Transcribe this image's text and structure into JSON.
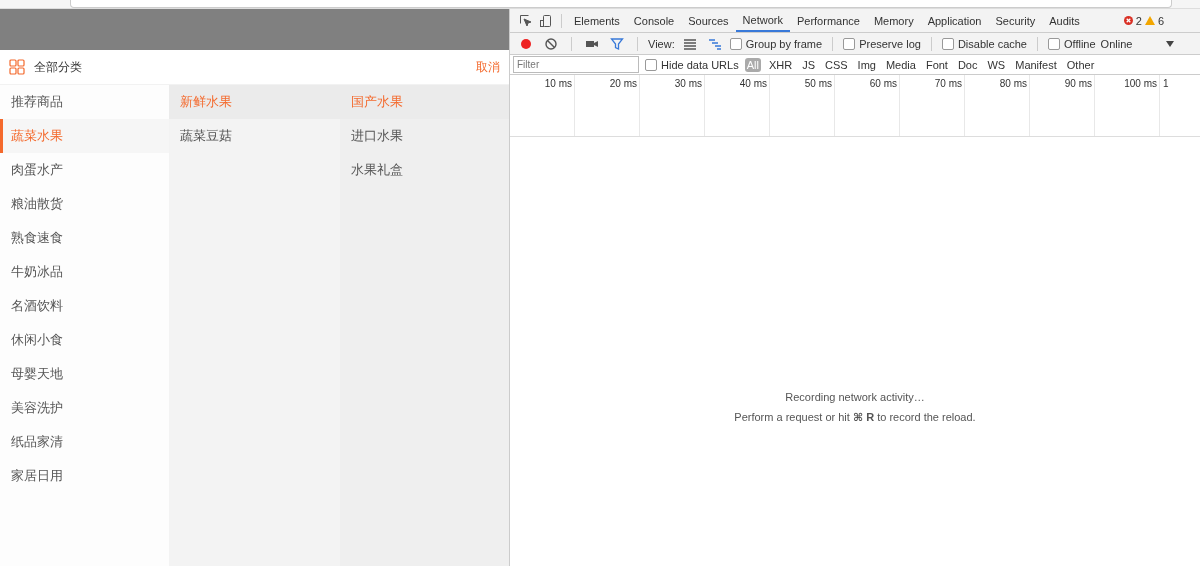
{
  "category_header": {
    "title": "全部分类",
    "cancel": "取消"
  },
  "categories": [
    {
      "label": "推荐商品",
      "selected": false
    },
    {
      "label": "蔬菜水果",
      "selected": true
    },
    {
      "label": "肉蛋水产",
      "selected": false
    },
    {
      "label": "粮油散货",
      "selected": false
    },
    {
      "label": "熟食速食",
      "selected": false
    },
    {
      "label": "牛奶冰品",
      "selected": false
    },
    {
      "label": "名酒饮料",
      "selected": false
    },
    {
      "label": "休闲小食",
      "selected": false
    },
    {
      "label": "母婴天地",
      "selected": false
    },
    {
      "label": "美容洗护",
      "selected": false
    },
    {
      "label": "纸品家清",
      "selected": false
    },
    {
      "label": "家居日用",
      "selected": false
    }
  ],
  "subcategory_columns": [
    [
      {
        "label": "新鲜水果",
        "selected": true
      },
      {
        "label": "蔬菜豆菇",
        "selected": false
      }
    ],
    [
      {
        "label": "国产水果",
        "selected": true
      },
      {
        "label": "进口水果",
        "selected": false
      },
      {
        "label": "水果礼盒",
        "selected": false
      }
    ]
  ],
  "devtools": {
    "tabs": [
      {
        "label": "Elements",
        "selected": false
      },
      {
        "label": "Console",
        "selected": false
      },
      {
        "label": "Sources",
        "selected": false
      },
      {
        "label": "Network",
        "selected": true
      },
      {
        "label": "Performance",
        "selected": false
      },
      {
        "label": "Memory",
        "selected": false
      },
      {
        "label": "Application",
        "selected": false
      },
      {
        "label": "Security",
        "selected": false
      },
      {
        "label": "Audits",
        "selected": false
      }
    ],
    "errors": "2",
    "warnings": "6",
    "recording": true,
    "view_label": "View:",
    "options": [
      {
        "label": "Group by frame",
        "checked": false
      },
      {
        "label": "Preserve log",
        "checked": false
      },
      {
        "label": "Disable cache",
        "checked": false
      },
      {
        "label": "Offline",
        "checked": false
      }
    ],
    "throttling": "Online",
    "filter": {
      "placeholder": "Filter"
    },
    "hide_data_urls": {
      "label": "Hide data URLs",
      "checked": false
    },
    "types": [
      {
        "label": "All",
        "selected": true
      },
      {
        "label": "XHR",
        "selected": false
      },
      {
        "label": "JS",
        "selected": false
      },
      {
        "label": "CSS",
        "selected": false
      },
      {
        "label": "Img",
        "selected": false
      },
      {
        "label": "Media",
        "selected": false
      },
      {
        "label": "Font",
        "selected": false
      },
      {
        "label": "Doc",
        "selected": false
      },
      {
        "label": "WS",
        "selected": false
      },
      {
        "label": "Manifest",
        "selected": false
      },
      {
        "label": "Other",
        "selected": false
      }
    ],
    "ticks": [
      "10 ms",
      "20 ms",
      "30 ms",
      "40 ms",
      "50 ms",
      "60 ms",
      "70 ms",
      "80 ms",
      "90 ms",
      "100 ms",
      "1"
    ],
    "message": "Recording network activity…",
    "hint": {
      "before": "Perform a request or hit",
      "key": "⌘ R",
      "after": "to record the reload."
    }
  }
}
